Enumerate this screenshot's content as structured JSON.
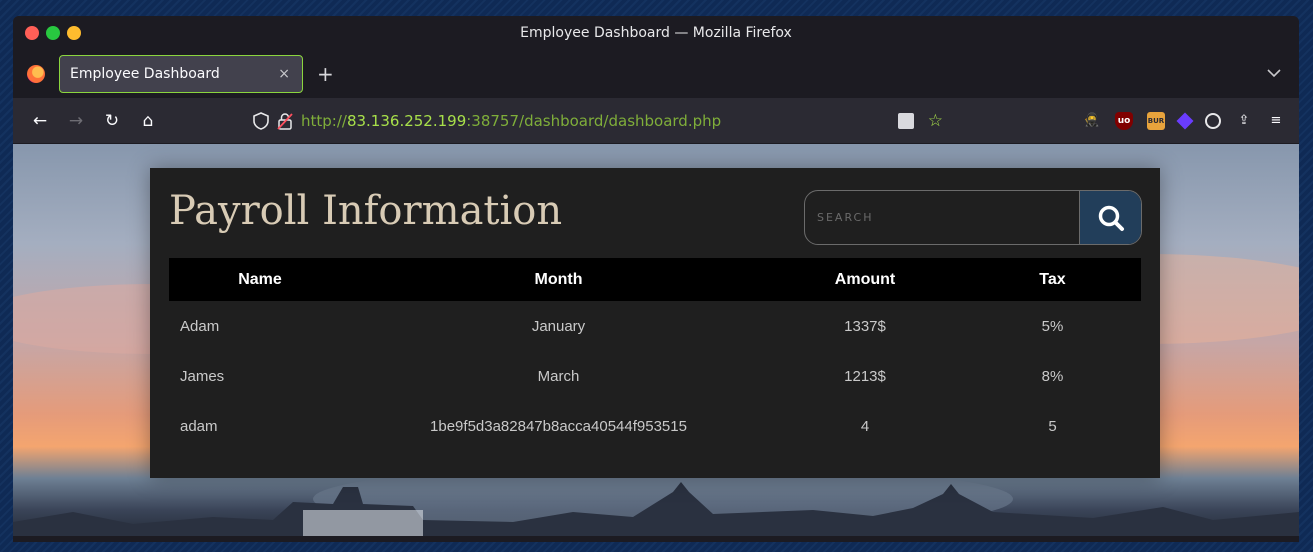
{
  "window": {
    "title": "Employee Dashboard — Mozilla Firefox",
    "colors": {
      "close": "#ff5f57",
      "minimize": "#28c840",
      "maximize": "#febc2e"
    }
  },
  "tabs": [
    {
      "label": "Employee Dashboard",
      "close": "×",
      "active": true
    }
  ],
  "tabbar": {
    "new_tab": "+",
    "list_all": "⌄"
  },
  "nav": {
    "back": "←",
    "forward": "→",
    "reload": "↻",
    "home": "⌂"
  },
  "urlbar": {
    "scheme": "http://",
    "host": "83.136.252.199",
    "rest": ":38757/dashboard/dashboard.php",
    "bookmark_star": "☆",
    "colors": {
      "url": "#7fae3a",
      "host": "#a8e04a"
    }
  },
  "extensions": [
    {
      "name": "hackbar-icon",
      "glyph": "🥷"
    },
    {
      "name": "ublock-origin-icon",
      "glyph": "uo"
    },
    {
      "name": "burp-proxy-icon",
      "glyph": "BUR"
    },
    {
      "name": "wappalyzer-icon",
      "glyph": ""
    },
    {
      "name": "cookie-editor-icon",
      "glyph": ""
    },
    {
      "name": "extensions-menu-icon",
      "glyph": "⇪"
    },
    {
      "name": "app-menu-icon",
      "glyph": "≡"
    }
  ],
  "page": {
    "title": "Payroll Information",
    "search": {
      "placeholder": "SEARCH",
      "value": ""
    },
    "table": {
      "headers": [
        "Name",
        "Month",
        "Amount",
        "Tax"
      ],
      "rows": [
        [
          "Adam",
          "January",
          "1337$",
          "5%"
        ],
        [
          "James",
          "March",
          "1213$",
          "8%"
        ],
        [
          "adam",
          "1be9f5d3a82847b8acca40544f953515",
          "4",
          "5"
        ]
      ]
    },
    "colors": {
      "panel_bg": "#1f1f1f",
      "title": "#d8cbb5",
      "search_button": "#223e5a",
      "header_bg": "#000000"
    }
  }
}
